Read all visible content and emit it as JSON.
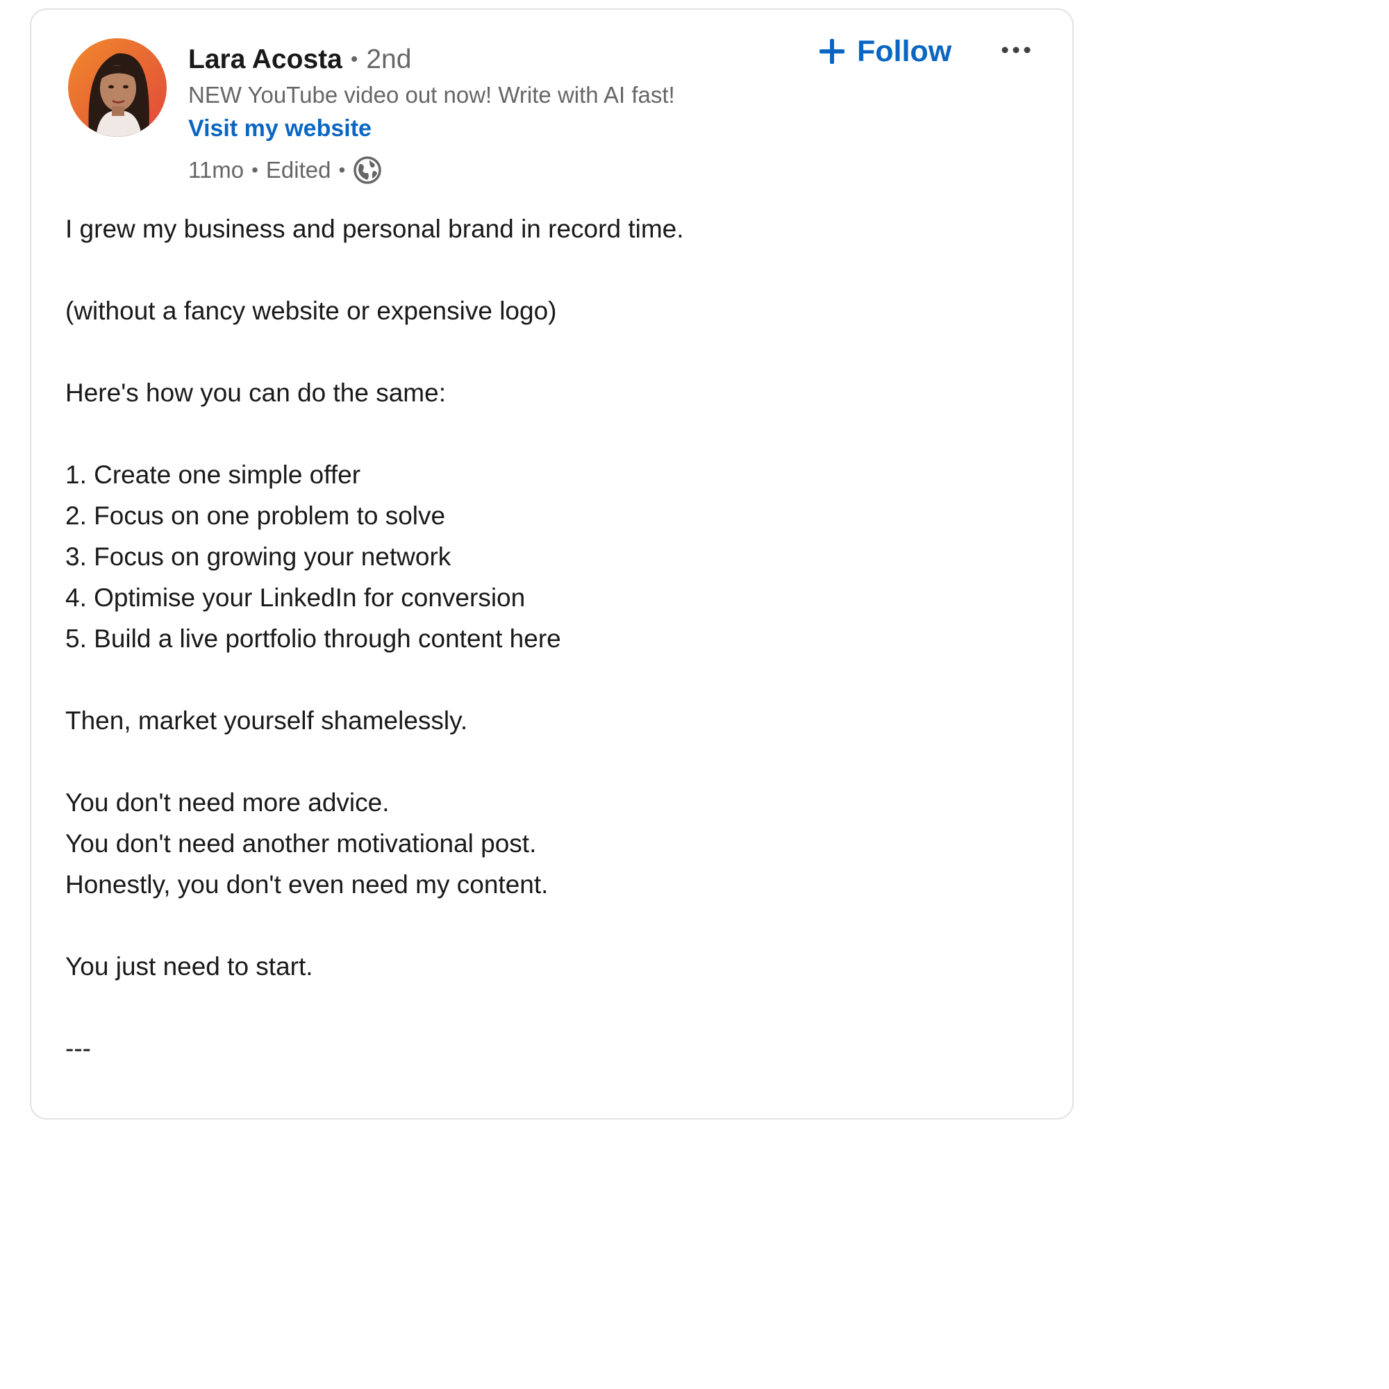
{
  "author": {
    "name": "Lara Acosta",
    "separator": "•",
    "degree": "2nd",
    "headline": "NEW YouTube video out now! Write with AI fast!",
    "website_link": "Visit my website"
  },
  "meta": {
    "time": "11mo",
    "separator": "•",
    "edited": "Edited",
    "visibility_icon": "globe-icon"
  },
  "actions": {
    "follow_label": "Follow",
    "follow_icon": "plus-icon",
    "more_icon": "more-options-icon"
  },
  "colors": {
    "link_blue": "#0a66c2",
    "text_primary": "#191919",
    "text_secondary": "#666666"
  },
  "post": {
    "lines": [
      "I grew my business and personal brand in record time.",
      "",
      "(without a fancy website or expensive logo)",
      "",
      "Here's how you can do the same:",
      "",
      "1. Create one simple offer",
      "2. Focus on one problem to solve",
      "3. Focus on growing your network",
      "4. Optimise your LinkedIn for conversion",
      "5. Build a live portfolio through content here",
      "",
      "Then, market yourself shamelessly.",
      "",
      "You don't need more advice.",
      "You don't need another motivational post.",
      "Honestly, you don't even need my content.",
      "",
      "You just need to start.",
      "",
      "---"
    ]
  }
}
